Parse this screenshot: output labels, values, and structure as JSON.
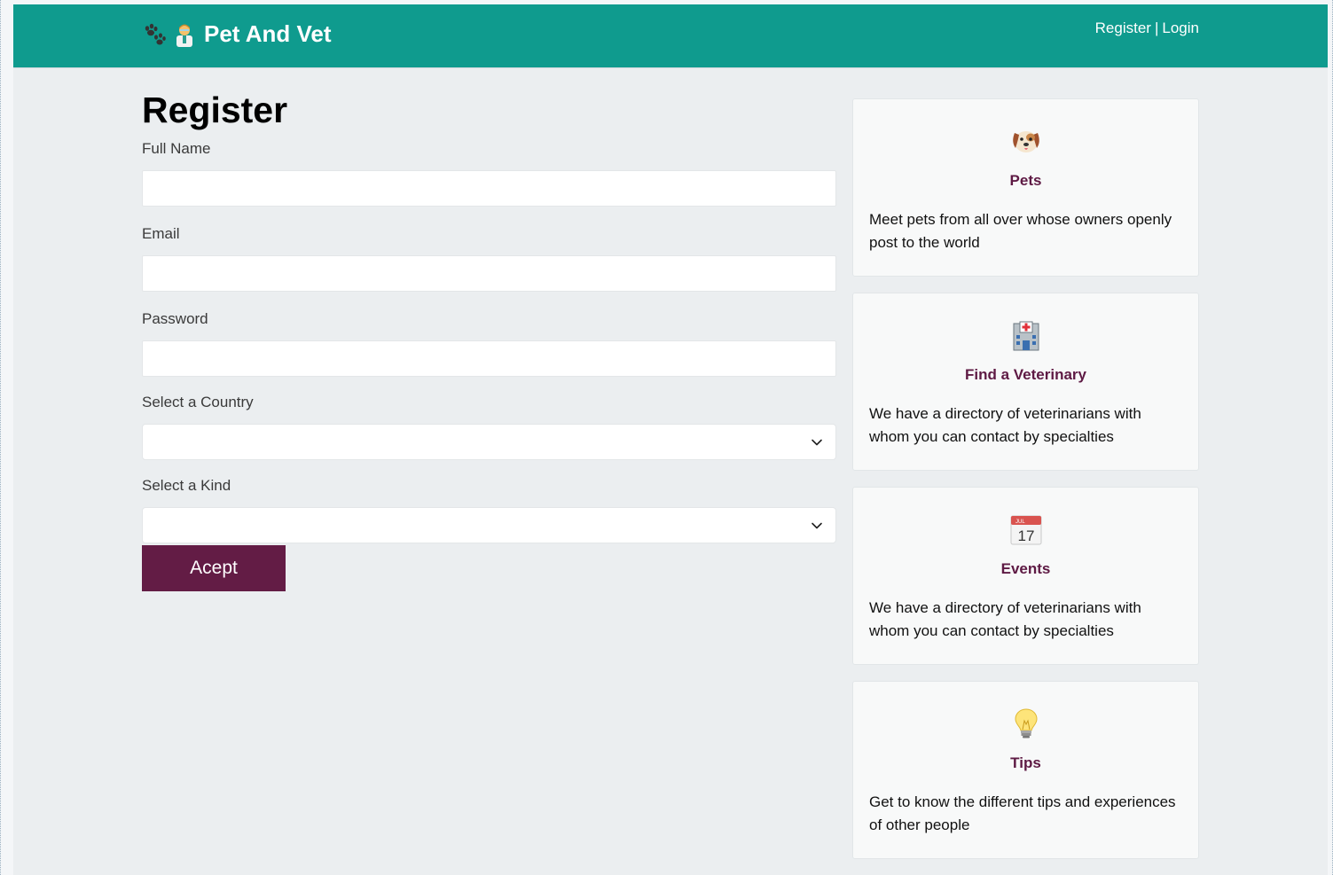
{
  "header": {
    "brand_text": "Pet And Vet",
    "register_link": "Register",
    "separator": "|",
    "login_link": "Login",
    "brand_color": "#0f9b8e"
  },
  "form": {
    "title": "Register",
    "fields": {
      "full_name": {
        "label": "Full Name",
        "value": ""
      },
      "email": {
        "label": "Email",
        "value": ""
      },
      "password": {
        "label": "Password",
        "value": ""
      },
      "country": {
        "label": "Select a Country",
        "selected": ""
      },
      "kind": {
        "label": "Select a Kind",
        "selected": ""
      }
    },
    "submit_label": "Acept",
    "submit_color": "#631c45"
  },
  "cards": [
    {
      "icon": "dog-face-icon",
      "title": "Pets",
      "text": "Meet pets from all over whose owners openly post to the world"
    },
    {
      "icon": "hospital-icon",
      "title": "Find a Veterinary",
      "text": "We have a directory of veterinarians with whom you can contact by specialties"
    },
    {
      "icon": "calendar-icon",
      "title": "Events",
      "text": "We have a directory of veterinarians with whom you can contact by specialties"
    },
    {
      "icon": "light-bulb-icon",
      "title": "Tips",
      "text": "Get to know the different tips and experiences of other people"
    }
  ],
  "card_title_color": "#5e1a44"
}
